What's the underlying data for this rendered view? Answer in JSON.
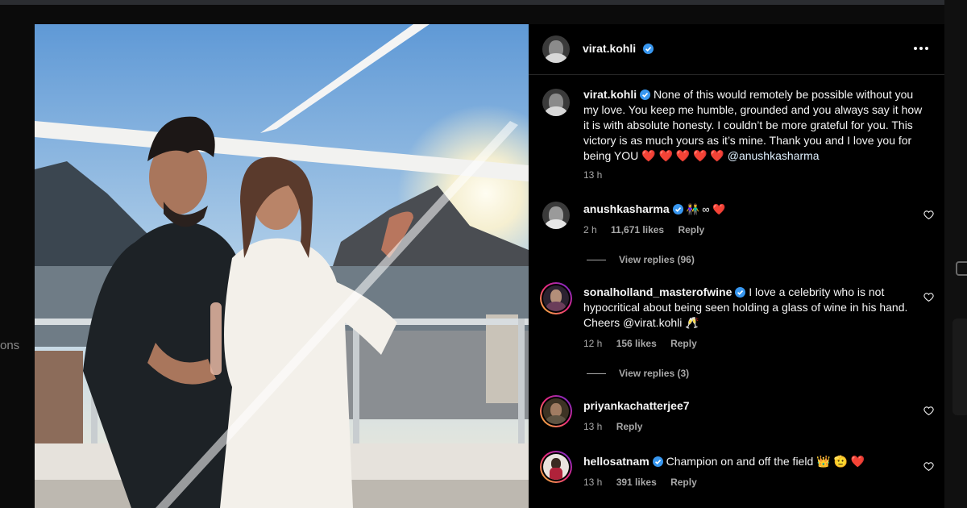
{
  "left_gutter": {
    "text": "ons"
  },
  "post": {
    "author": "virat.kohli",
    "caption": {
      "username": "virat.kohli",
      "text": "None of this would remotely be possible without you my love. You keep me humble, grounded and you always say it how it is with absolute honesty. I couldn’t be more grateful for you. This victory is as much yours as it’s mine. Thank you and I love you for being YOU",
      "hearts": "❤️ ❤️ ❤️ ❤️ ❤️",
      "mention": "@anushkasharma",
      "time": "13 h"
    }
  },
  "comments": [
    {
      "username": "anushkasharma",
      "verified": true,
      "text": "👫 ∞ ❤️",
      "time": "2 h",
      "likes": "11,671 likes",
      "reply": "Reply",
      "view_replies": "View replies (96)"
    },
    {
      "username": "sonalholland_masterofwine",
      "verified": true,
      "text": "I love a celebrity who is not hypocritical about being seen holding a glass of wine in his hand. Cheers @virat.kohli 🥂",
      "time": "12 h",
      "likes": "156 likes",
      "reply": "Reply",
      "view_replies": "View replies (3)"
    },
    {
      "username": "priyankachatterjee7",
      "verified": false,
      "text": "",
      "time": "13 h",
      "likes": "",
      "reply": "Reply"
    },
    {
      "username": "hellosatnam",
      "verified": true,
      "text": "Champion on and off the field 👑 🫡 ❤️",
      "time": "13 h",
      "likes": "391 likes",
      "reply": "Reply"
    }
  ],
  "colors": {
    "background": "#000000",
    "verified": "#3897f0",
    "heart": "#ff3040",
    "muted": "#a8a8a8"
  }
}
